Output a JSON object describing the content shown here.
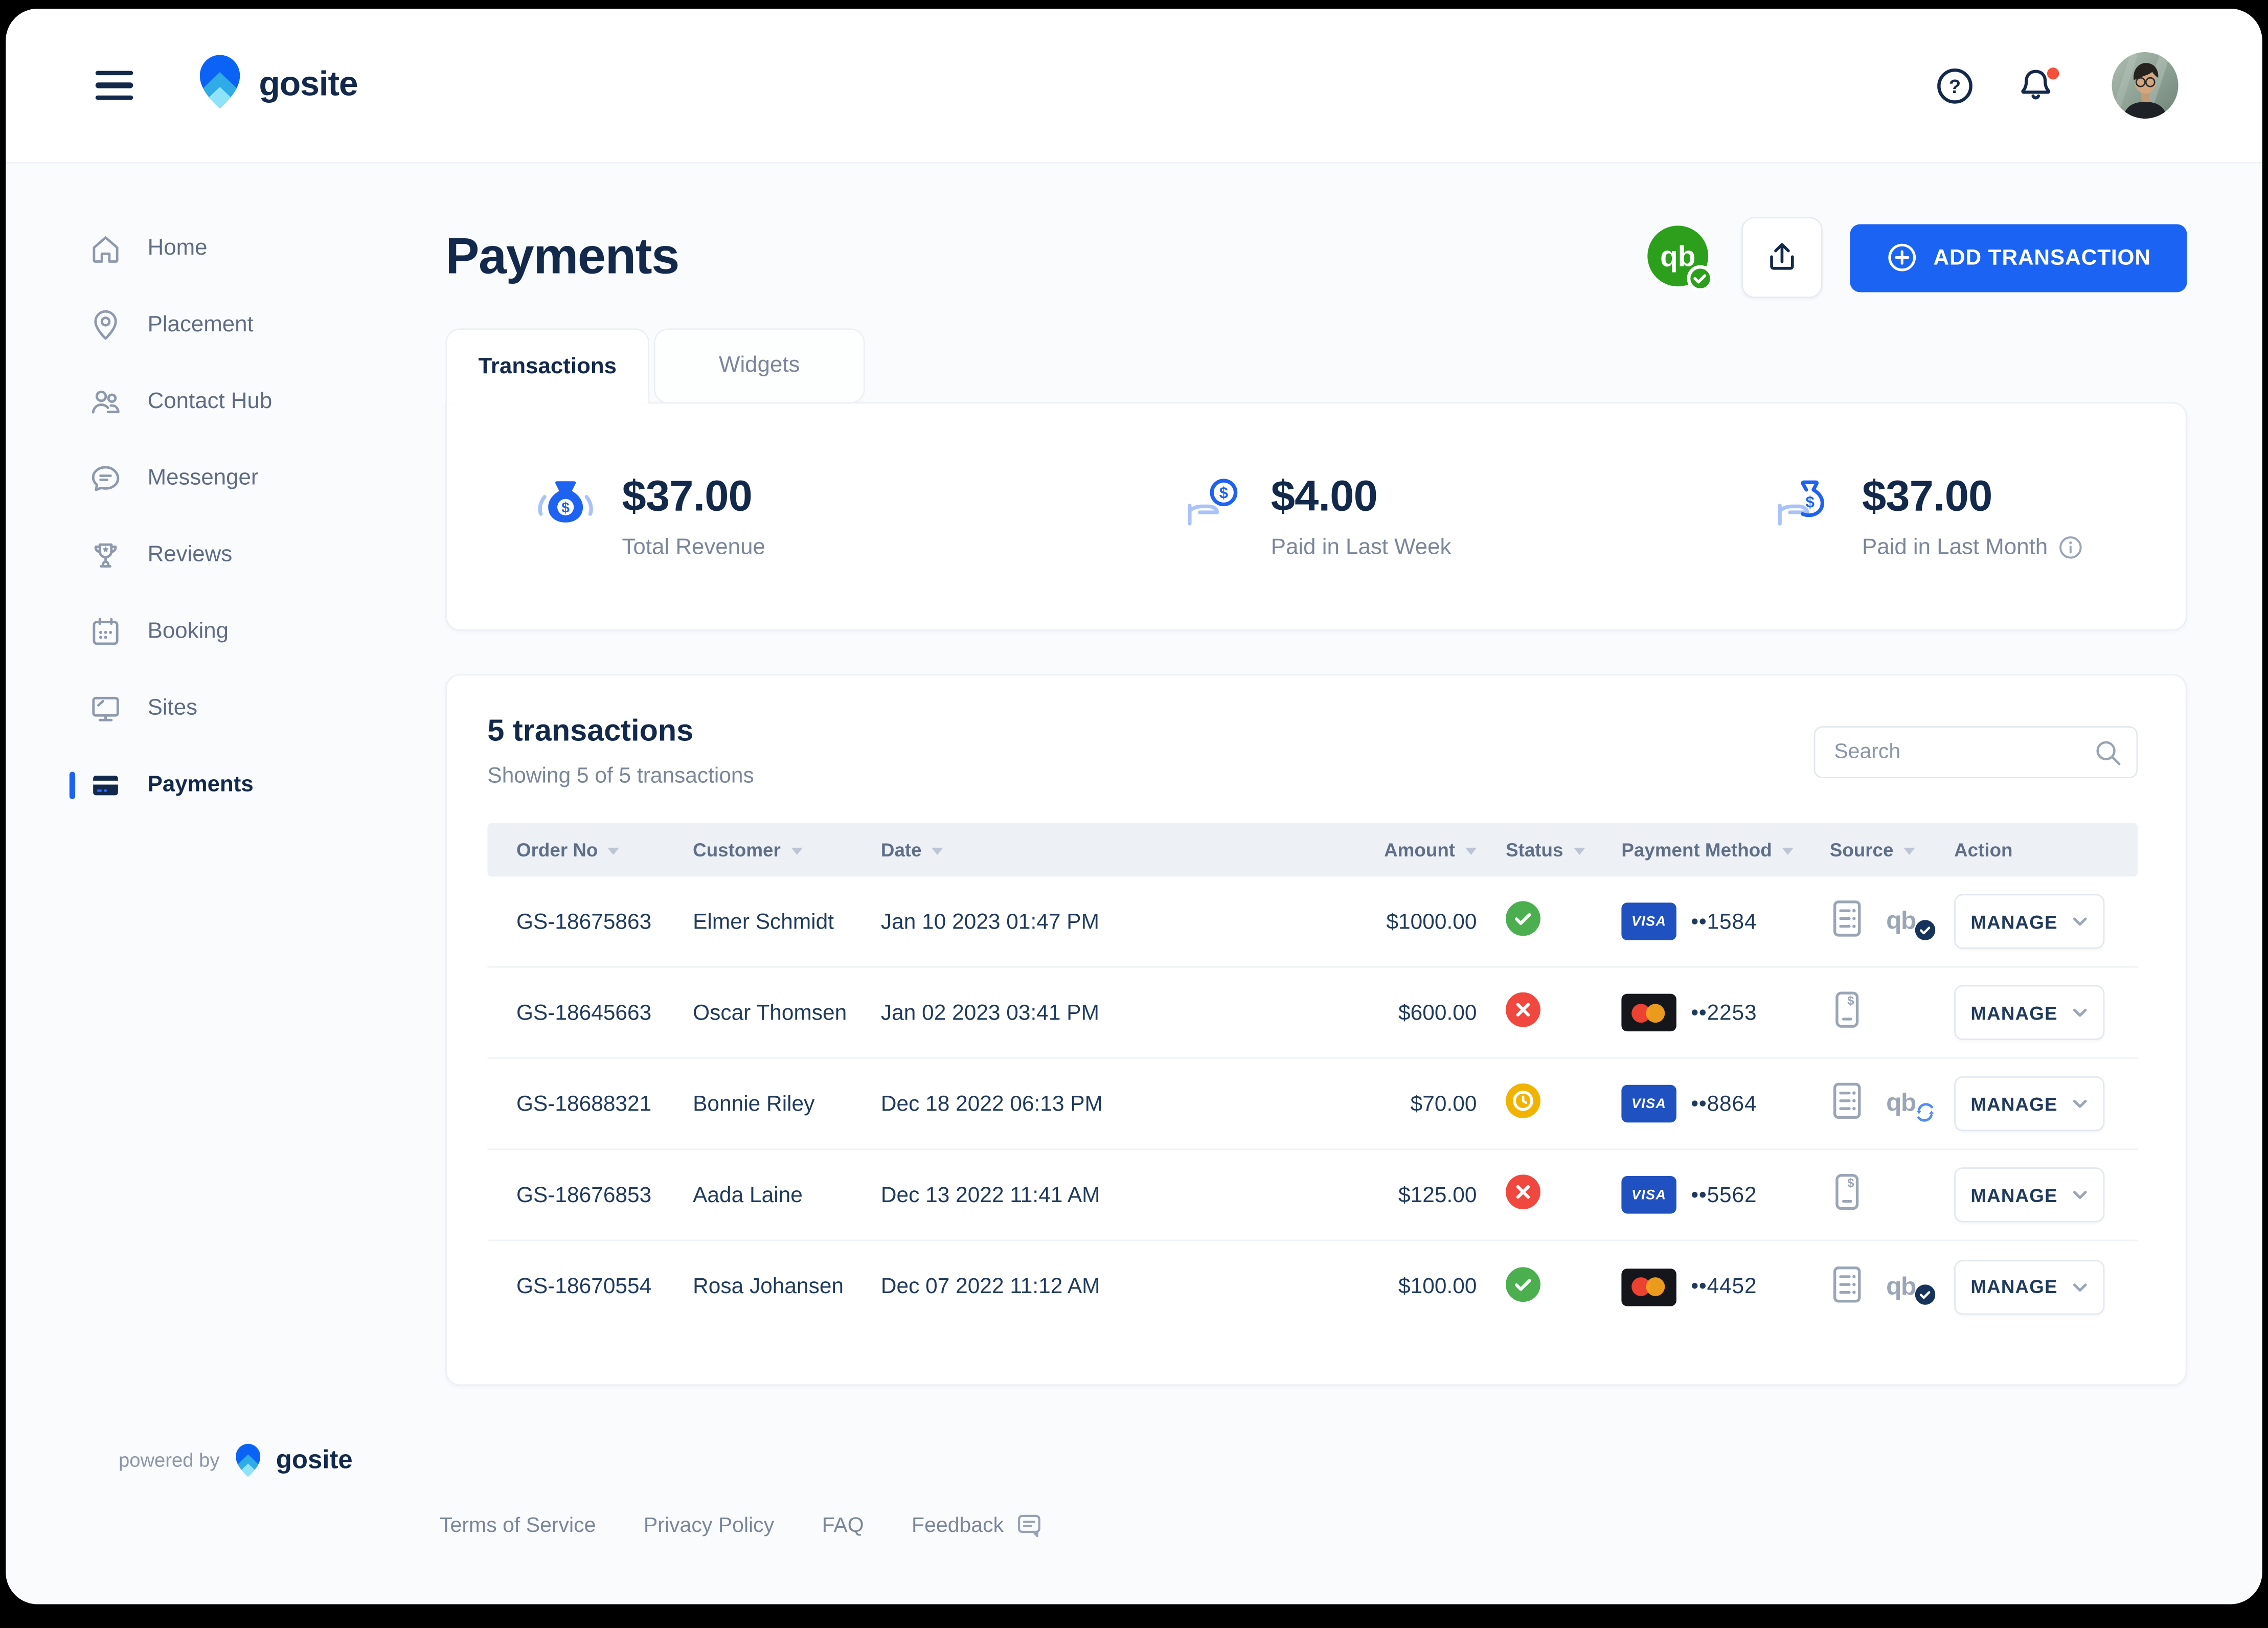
{
  "colors": {
    "accent_blue": "#1B63F2",
    "navy": "#13294B",
    "status_green": "#4BAE4F",
    "status_red": "#F0483E",
    "status_yellow": "#F0B400",
    "quickbooks_green": "#2CA01C",
    "visa_blue": "#1F51C0",
    "content_bg": "#FAFBFD",
    "table_header_bg": "#EDF1F6"
  },
  "header": {
    "brand": "gosite"
  },
  "quickbooks": {
    "lettermark": "qb"
  },
  "sidebar": {
    "items": [
      {
        "label": "Home",
        "icon": "home-icon",
        "active": false
      },
      {
        "label": "Placement",
        "icon": "placement-pin-icon",
        "active": false
      },
      {
        "label": "Contact Hub",
        "icon": "contacts-icon",
        "active": false
      },
      {
        "label": "Messenger",
        "icon": "messenger-icon",
        "active": false
      },
      {
        "label": "Reviews",
        "icon": "reviews-trophy-icon",
        "active": false
      },
      {
        "label": "Booking",
        "icon": "booking-calendar-icon",
        "active": false
      },
      {
        "label": "Sites",
        "icon": "sites-monitor-icon",
        "active": false
      },
      {
        "label": "Payments",
        "icon": "payments-card-icon",
        "active": true
      }
    ]
  },
  "page": {
    "title": "Payments",
    "tabs": [
      {
        "label": "Transactions",
        "active": true
      },
      {
        "label": "Widgets",
        "active": false
      }
    ],
    "add_transaction_label": "ADD TRANSACTION"
  },
  "stats": [
    {
      "value": "$37.00",
      "label": "Total Revenue",
      "icon": "money-bag-icon"
    },
    {
      "value": "$4.00",
      "label": "Paid in Last Week",
      "icon": "hand-coin-icon"
    },
    {
      "value": "$37.00",
      "label": "Paid in Last Month",
      "icon": "hand-moneybag-icon",
      "info_icon": true
    }
  ],
  "transactions": {
    "title": "5 transactions",
    "subtitle": "Showing 5 of 5 transactions",
    "search_placeholder": "Search",
    "manage_label": "MANAGE",
    "payment_brand_labels": {
      "visa": "VISA"
    },
    "columns": [
      {
        "label": "Order  No",
        "sortable": true
      },
      {
        "label": "Customer",
        "sortable": true
      },
      {
        "label": "Date",
        "sortable": true
      },
      {
        "label": "Amount",
        "sortable": true
      },
      {
        "label": "Status",
        "sortable": true
      },
      {
        "label": "Payment Method",
        "sortable": true
      },
      {
        "label": "Source",
        "sortable": true
      },
      {
        "label": "Action",
        "sortable": false
      }
    ],
    "rows": [
      {
        "order_no": "GS-18675863",
        "customer": "Elmer Schmidt",
        "date": "Jan 10 2023 01:47 PM",
        "amount": "$1000.00",
        "status": "paid",
        "card_brand": "visa",
        "card_mask": "••1584",
        "source": "invoice-quickbooks",
        "qb_badge": "synced"
      },
      {
        "order_no": "GS-18645663",
        "customer": "Oscar Thomsen",
        "date": "Jan 02 2023 03:41 PM",
        "amount": "$600.00",
        "status": "failed",
        "card_brand": "mastercard",
        "card_mask": "••2253",
        "source": "mobile"
      },
      {
        "order_no": "GS-18688321",
        "customer": "Bonnie Riley",
        "date": "Dec 18 2022 06:13 PM",
        "amount": "$70.00",
        "status": "pending",
        "card_brand": "visa",
        "card_mask": "••8864",
        "source": "invoice-quickbooks",
        "qb_badge": "syncing"
      },
      {
        "order_no": "GS-18676853",
        "customer": "Aada Laine",
        "date": "Dec 13 2022 11:41 AM",
        "amount": "$125.00",
        "status": "failed",
        "card_brand": "visa",
        "card_mask": "••5562",
        "source": "mobile"
      },
      {
        "order_no": "GS-18670554",
        "customer": "Rosa Johansen",
        "date": "Dec 07 2022 11:12 AM",
        "amount": "$100.00",
        "status": "paid",
        "card_brand": "mastercard",
        "card_mask": "••4452",
        "source": "invoice-quickbooks",
        "qb_badge": "synced"
      }
    ]
  },
  "footer": {
    "powered_by": "powered by",
    "brand": "gosite",
    "links": [
      "Terms of Service",
      "Privacy Policy",
      "FAQ",
      "Feedback"
    ]
  }
}
